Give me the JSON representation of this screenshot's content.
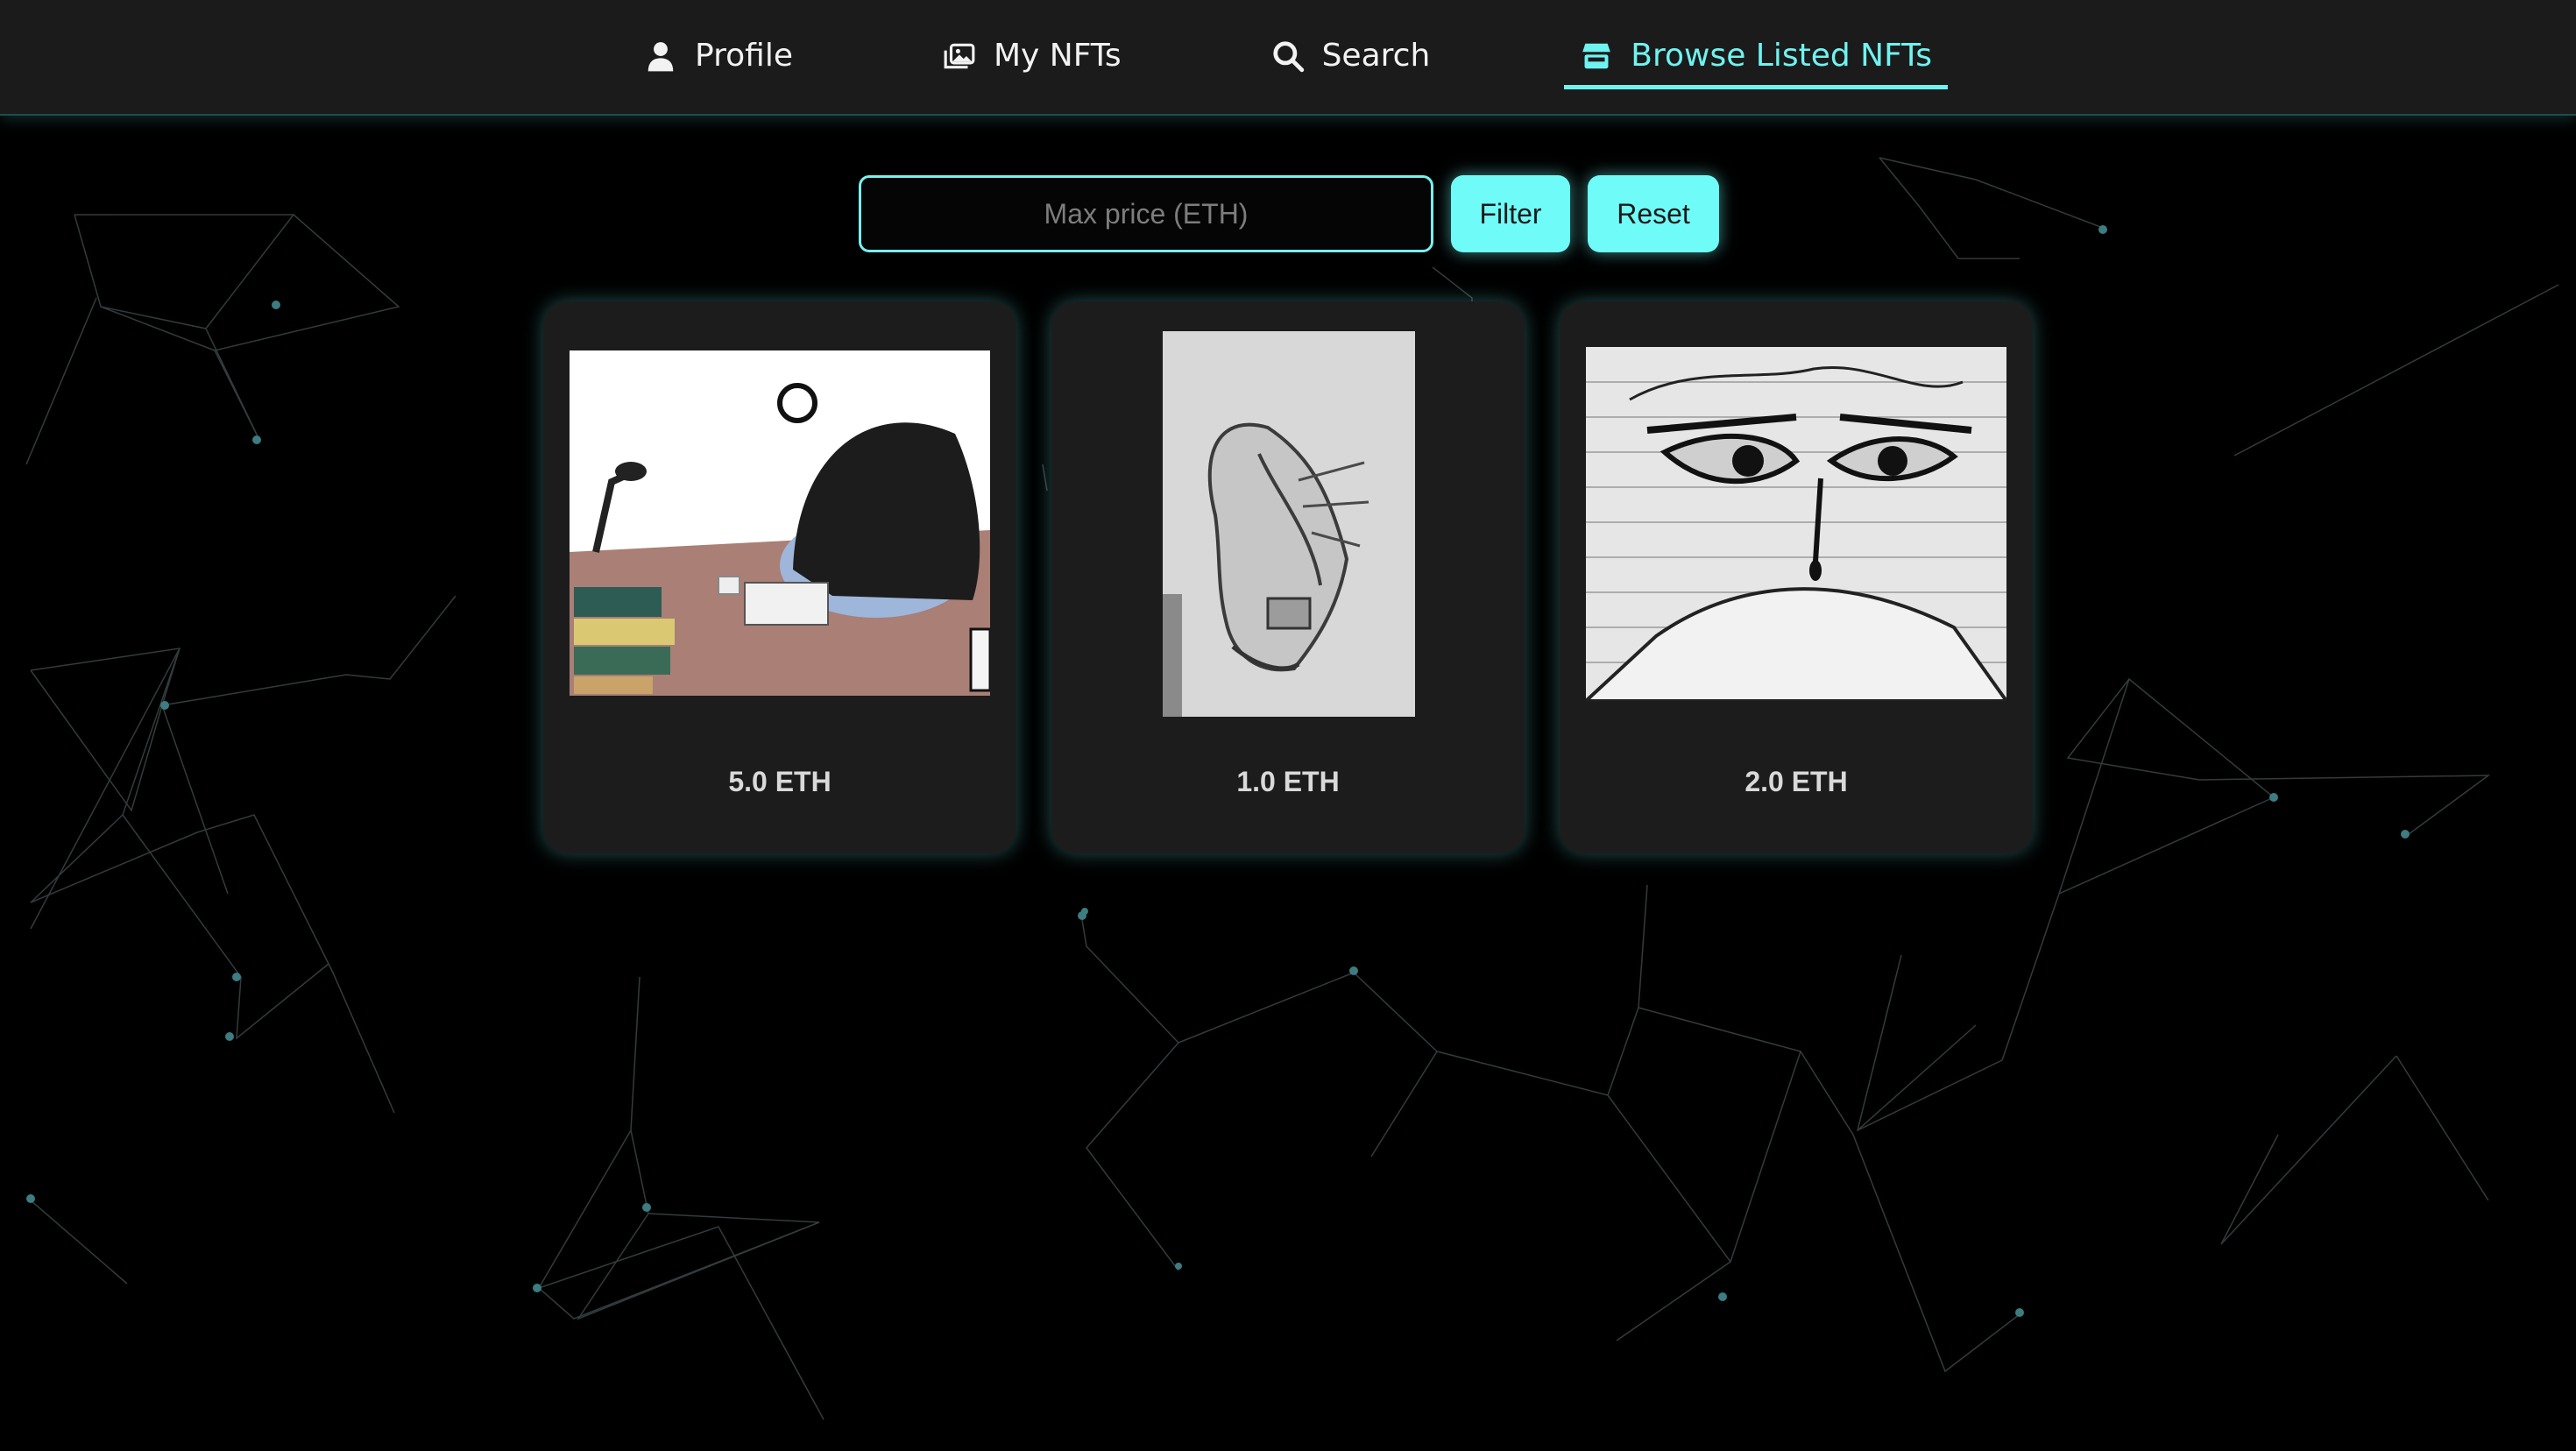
{
  "nav": {
    "items": [
      {
        "label": "Profile",
        "icon": "user-icon",
        "active": false
      },
      {
        "label": "My NFTs",
        "icon": "images-icon",
        "active": false
      },
      {
        "label": "Search",
        "icon": "search-icon",
        "active": false
      },
      {
        "label": "Browse Listed NFTs",
        "icon": "store-icon",
        "active": true
      }
    ]
  },
  "filter": {
    "placeholder": "Max price (ETH)",
    "value": "",
    "filter_label": "Filter",
    "reset_label": "Reset"
  },
  "listings": [
    {
      "image": "anime girl slumped over desk illustration",
      "price": "5.0 ETH"
    },
    {
      "image": "pencil sketch of a sneaker",
      "price": "1.0 ETH"
    },
    {
      "image": "ink sketch of intense eyes on lined paper",
      "price": "2.0 ETH"
    }
  ],
  "colors": {
    "accent": "#6ffcf8",
    "background": "#000000",
    "navbar": "#1b1b1b",
    "card": "#1c1c1c"
  }
}
